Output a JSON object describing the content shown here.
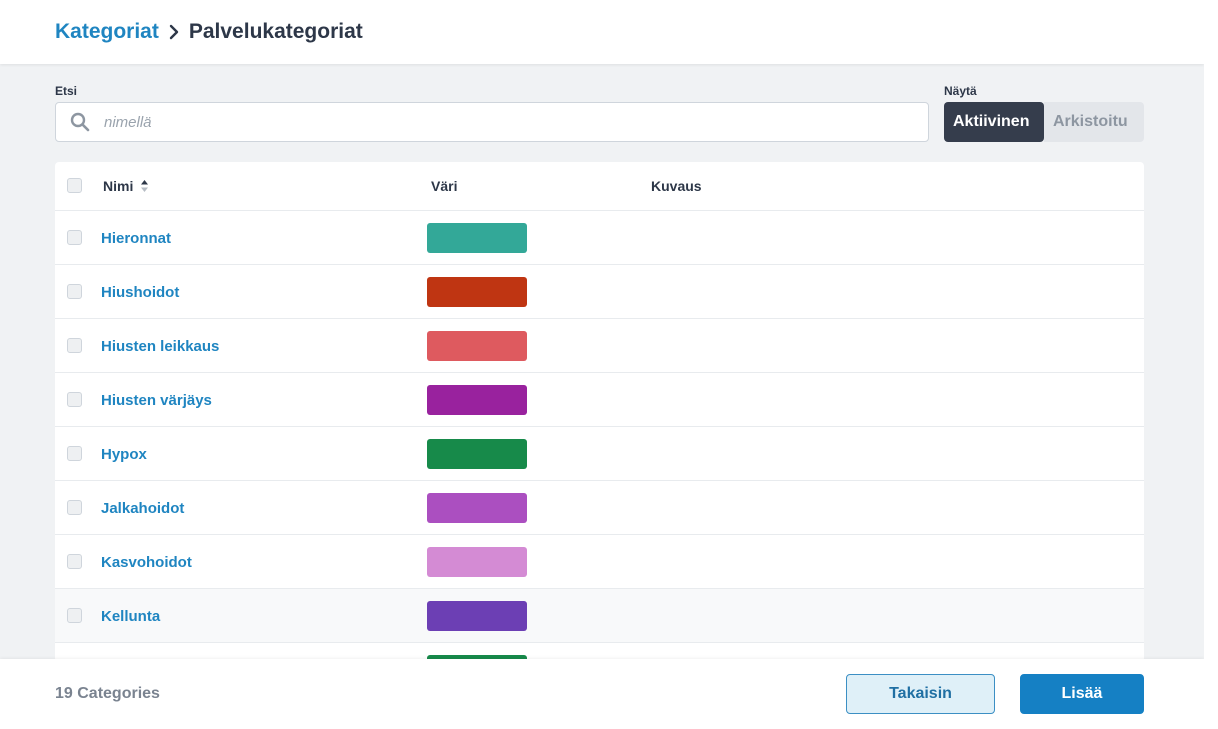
{
  "breadcrumb": {
    "parent": "Kategoriat",
    "current": "Palvelukategoriat"
  },
  "search": {
    "label": "Etsi",
    "placeholder": "nimellä",
    "value": ""
  },
  "show": {
    "label": "Näytä",
    "active": "Aktiivinen",
    "archived": "Arkistoitu"
  },
  "table": {
    "columns": {
      "name": "Nimi",
      "color": "Väri",
      "description": "Kuvaus"
    },
    "rows": [
      {
        "name": "Hieronnat",
        "color": "#33a898",
        "description": ""
      },
      {
        "name": "Hiushoidot",
        "color": "#bf3512",
        "description": ""
      },
      {
        "name": "Hiusten leikkaus",
        "color": "#de5a5f",
        "description": ""
      },
      {
        "name": "Hiusten värjäys",
        "color": "#99229e",
        "description": ""
      },
      {
        "name": "Hypox",
        "color": "#178a4a",
        "description": ""
      },
      {
        "name": "Jalkahoidot",
        "color": "#ab4fc0",
        "description": ""
      },
      {
        "name": "Kasvohoidot",
        "color": "#d48bd4",
        "description": ""
      },
      {
        "name": "Kellunta",
        "color": "#6c3fb4",
        "description": ""
      },
      {
        "name": "",
        "color": "#178a4a",
        "description": ""
      }
    ]
  },
  "footer": {
    "count": "19 Categories",
    "back": "Takaisin",
    "add": "Lisää"
  },
  "icons": {
    "sort": "sort-asc-icon",
    "search": "search-icon",
    "separator": "chevron-right-icon"
  }
}
